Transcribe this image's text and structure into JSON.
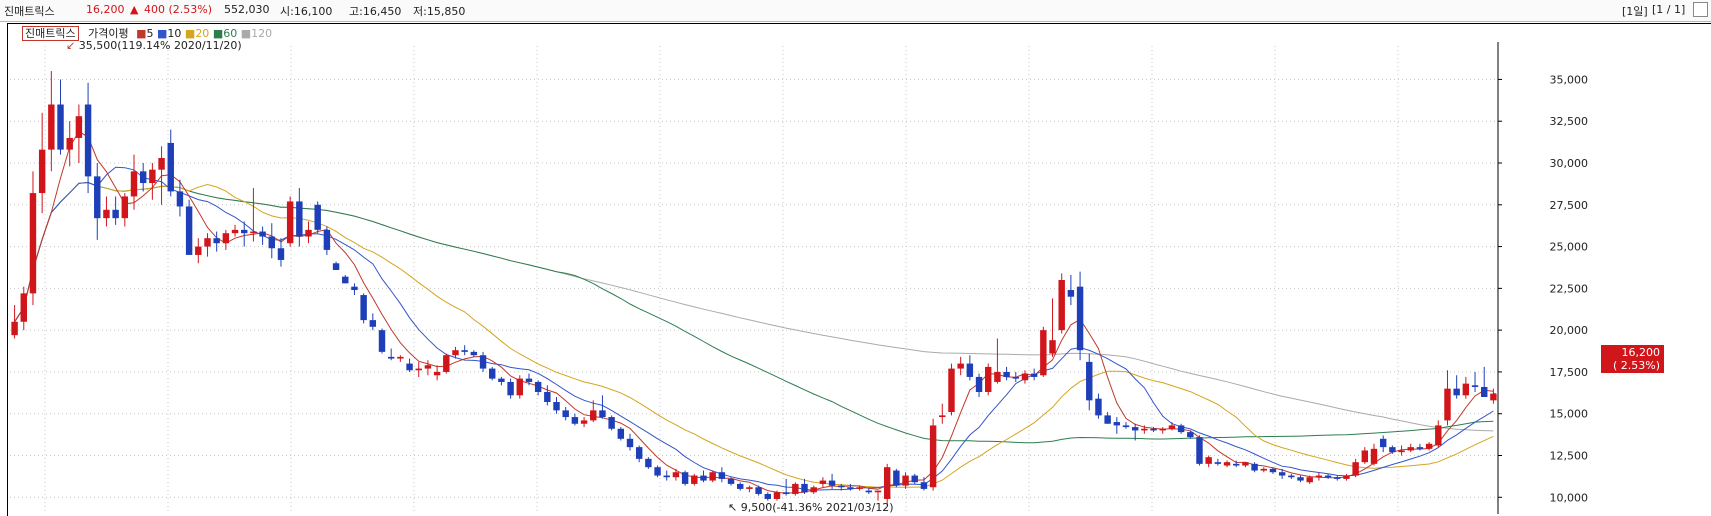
{
  "header": {
    "stock_name": "진매트릭스",
    "price": "16,200",
    "change_arrow": "▲",
    "change": "400 (2.53%)",
    "volume": "552,030",
    "open": "시:16,100",
    "high": "고:16,450",
    "low": "저:15,850",
    "period": "[1일]",
    "page": "[1 / 1]"
  },
  "legend": {
    "name": "진매트릭스",
    "ma_title": "가격이평",
    "periods": [
      {
        "label": "5",
        "color": "#c0392b"
      },
      {
        "label": "10",
        "color": "#3355cc"
      },
      {
        "label": "20",
        "color": "#d4a520"
      },
      {
        "label": "60",
        "color": "#2e7d4f"
      },
      {
        "label": "120",
        "color": "#aaaaaa"
      }
    ]
  },
  "annotations": {
    "high": "35,500(119.14% 2020/11/20)",
    "low": "9,500(-41.36% 2021/03/12)"
  },
  "price_tag": {
    "price": "16,200",
    "pct": "( 2.53%)"
  },
  "colors": {
    "up": "#d0161b",
    "down": "#1f3fb8",
    "bg": "#ffffff",
    "grid": "#c8c8c8"
  },
  "chart_data": {
    "type": "candlestick",
    "ylim": [
      9000,
      37000
    ],
    "yticks": [
      10000,
      12500,
      15000,
      17500,
      20000,
      22500,
      25000,
      27500,
      30000,
      32500,
      35000
    ],
    "ytick_labels": [
      "10,000",
      "12,500",
      "15,000",
      "17,500",
      "20,000",
      "22,500",
      "25,000",
      "27,500",
      "30,000",
      "32,500",
      "35,000"
    ],
    "candles": [
      [
        19700,
        21500,
        19500,
        20500
      ],
      [
        20500,
        22600,
        20000,
        22200
      ],
      [
        22200,
        29500,
        21500,
        28200
      ],
      [
        28200,
        33000,
        27000,
        30800
      ],
      [
        30800,
        35500,
        29500,
        33500
      ],
      [
        33500,
        35000,
        30500,
        30800
      ],
      [
        30800,
        32500,
        29800,
        31500
      ],
      [
        31500,
        33500,
        30000,
        32800
      ],
      [
        33500,
        34800,
        28200,
        29200
      ],
      [
        29200,
        30000,
        25400,
        26700
      ],
      [
        26700,
        28000,
        26200,
        27200
      ],
      [
        27200,
        28000,
        26300,
        26700
      ],
      [
        26700,
        28200,
        26200,
        28000
      ],
      [
        28000,
        30500,
        27200,
        29500
      ],
      [
        29500,
        30000,
        28300,
        28800
      ],
      [
        28800,
        30000,
        27800,
        29600
      ],
      [
        29600,
        31000,
        27500,
        30300
      ],
      [
        31200,
        32000,
        28000,
        28300
      ],
      [
        28300,
        29000,
        26800,
        27400
      ],
      [
        27400,
        27800,
        25100,
        24500
      ],
      [
        24500,
        25500,
        24000,
        25000
      ],
      [
        25000,
        25800,
        24400,
        25500
      ],
      [
        25500,
        25900,
        24700,
        25200
      ],
      [
        25200,
        26000,
        24800,
        25800
      ],
      [
        25800,
        26300,
        25600,
        26000
      ],
      [
        26000,
        26500,
        25000,
        25800
      ],
      [
        25800,
        28500,
        25300,
        25900
      ],
      [
        25900,
        26200,
        25100,
        25600
      ],
      [
        25600,
        26400,
        24300,
        24900
      ],
      [
        24900,
        25500,
        23800,
        24200
      ],
      [
        25200,
        28000,
        25000,
        27700
      ],
      [
        27700,
        28500,
        25000,
        25600
      ],
      [
        25600,
        26500,
        25200,
        26000
      ],
      [
        27500,
        27700,
        25800,
        26000
      ],
      [
        26000,
        26200,
        24500,
        24800
      ],
      [
        24000,
        24100,
        23600,
        23600
      ],
      [
        23200,
        23300,
        22800,
        22800
      ],
      [
        22600,
        22800,
        22100,
        22400
      ],
      [
        22100,
        22200,
        20400,
        20600
      ],
      [
        20600,
        21000,
        20000,
        20200
      ],
      [
        20000,
        20100,
        18600,
        18700
      ],
      [
        18400,
        18900,
        18200,
        18300
      ],
      [
        18300,
        18500,
        18100,
        18400
      ],
      [
        18000,
        18300,
        17500,
        17600
      ],
      [
        17600,
        18100,
        17200,
        17700
      ],
      [
        17700,
        18200,
        17300,
        17900
      ],
      [
        17300,
        17900,
        17000,
        17500
      ],
      [
        17500,
        18600,
        17400,
        18500
      ],
      [
        18500,
        19000,
        18300,
        18800
      ],
      [
        18800,
        19100,
        18500,
        18700
      ],
      [
        18700,
        18800,
        18400,
        18500
      ],
      [
        18500,
        18700,
        17500,
        17700
      ],
      [
        17700,
        17800,
        17000,
        17100
      ],
      [
        17100,
        17200,
        16700,
        16900
      ],
      [
        16900,
        17100,
        15900,
        16100
      ],
      [
        16100,
        17300,
        15900,
        17100
      ],
      [
        17100,
        17400,
        16700,
        16900
      ],
      [
        16900,
        17000,
        16100,
        16300
      ],
      [
        16300,
        16700,
        15500,
        15700
      ],
      [
        15700,
        16000,
        15000,
        15200
      ],
      [
        15200,
        15400,
        14600,
        14800
      ],
      [
        14800,
        15000,
        14300,
        14400
      ],
      [
        14400,
        14800,
        14200,
        14600
      ],
      [
        14600,
        15800,
        14500,
        15200
      ],
      [
        15200,
        16100,
        14700,
        14800
      ],
      [
        14800,
        14900,
        14000,
        14100
      ],
      [
        14100,
        14200,
        13400,
        13500
      ],
      [
        13500,
        13800,
        12800,
        13000
      ],
      [
        13000,
        13100,
        12100,
        12300
      ],
      [
        12300,
        12400,
        11700,
        11800
      ],
      [
        11800,
        11900,
        11200,
        11300
      ],
      [
        11300,
        11600,
        11000,
        11200
      ],
      [
        11200,
        11700,
        11000,
        11500
      ],
      [
        11500,
        11600,
        10700,
        10800
      ],
      [
        10800,
        11400,
        10700,
        11300
      ],
      [
        11300,
        11600,
        10900,
        11000
      ],
      [
        11000,
        11600,
        10900,
        11500
      ],
      [
        11500,
        11800,
        10900,
        11100
      ],
      [
        11100,
        11200,
        10700,
        10800
      ],
      [
        10800,
        10900,
        10400,
        10500
      ],
      [
        10500,
        10700,
        10300,
        10600
      ],
      [
        10600,
        10700,
        10100,
        10200
      ],
      [
        10200,
        10300,
        9800,
        9900
      ],
      [
        9900,
        10400,
        9800,
        10300
      ],
      [
        10300,
        11100,
        10100,
        10200
      ],
      [
        10200,
        10900,
        10100,
        10800
      ],
      [
        10800,
        11100,
        10200,
        10300
      ],
      [
        10300,
        10700,
        10200,
        10600
      ],
      [
        10800,
        11200,
        10600,
        11000
      ],
      [
        11000,
        11400,
        10500,
        10700
      ],
      [
        10700,
        10800,
        10400,
        10600
      ],
      [
        10600,
        10800,
        10400,
        10500
      ],
      [
        10500,
        10700,
        10400,
        10600
      ],
      [
        10400,
        10600,
        10200,
        10300
      ],
      [
        10300,
        10400,
        9800,
        10400
      ],
      [
        9900,
        12000,
        9500,
        11800
      ],
      [
        11600,
        11700,
        10600,
        10700
      ],
      [
        10700,
        11500,
        10500,
        11300
      ],
      [
        11300,
        11400,
        10800,
        10900
      ],
      [
        10900,
        11200,
        10400,
        10500
      ],
      [
        10600,
        14700,
        10400,
        14300
      ],
      [
        14800,
        15600,
        14400,
        14900
      ],
      [
        15100,
        18000,
        14900,
        17700
      ],
      [
        17700,
        18400,
        17300,
        18000
      ],
      [
        18000,
        18500,
        17000,
        17200
      ],
      [
        17200,
        17400,
        16000,
        16300
      ],
      [
        16300,
        18000,
        16100,
        17800
      ],
      [
        16900,
        19500,
        16800,
        17500
      ],
      [
        17500,
        17800,
        17000,
        17200
      ],
      [
        17200,
        17500,
        16900,
        17100
      ],
      [
        17000,
        17600,
        16800,
        17400
      ],
      [
        17400,
        17700,
        17000,
        17200
      ],
      [
        17300,
        20200,
        17200,
        20000
      ],
      [
        18600,
        21900,
        18400,
        19400
      ],
      [
        20000,
        23400,
        19800,
        23000
      ],
      [
        22400,
        23300,
        21500,
        22000
      ],
      [
        22600,
        23500,
        18200,
        18800
      ],
      [
        18100,
        18600,
        15200,
        15800
      ],
      [
        15900,
        16200,
        14700,
        14900
      ],
      [
        14900,
        15100,
        14400,
        14400
      ],
      [
        14500,
        14800,
        13800,
        14300
      ],
      [
        14300,
        14500,
        14100,
        14200
      ],
      [
        14200,
        14400,
        13400,
        14000
      ],
      [
        14000,
        14300,
        13800,
        14100
      ],
      [
        14100,
        14200,
        13900,
        14000
      ],
      [
        14000,
        14200,
        13800,
        14100
      ],
      [
        14100,
        14500,
        14000,
        14300
      ],
      [
        14300,
        14400,
        13800,
        13900
      ],
      [
        13900,
        14000,
        13500,
        13600
      ],
      [
        13600,
        13700,
        11900,
        12000
      ],
      [
        12000,
        12500,
        11800,
        12400
      ],
      [
        12100,
        12300,
        11900,
        12000
      ],
      [
        11900,
        12200,
        11800,
        12100
      ],
      [
        12000,
        12200,
        11800,
        11900
      ],
      [
        11900,
        12100,
        11800,
        12100
      ],
      [
        12000,
        12100,
        11500,
        11600
      ],
      [
        11600,
        11800,
        11500,
        11700
      ],
      [
        11700,
        11800,
        11400,
        11500
      ],
      [
        11500,
        11700,
        11100,
        11300
      ],
      [
        11300,
        11400,
        11100,
        11200
      ],
      [
        11200,
        11300,
        10900,
        11000
      ],
      [
        10900,
        11300,
        10800,
        11200
      ],
      [
        11200,
        11500,
        11000,
        11300
      ],
      [
        11300,
        11400,
        11100,
        11200
      ],
      [
        11200,
        11300,
        11000,
        11100
      ],
      [
        11100,
        11400,
        11000,
        11300
      ],
      [
        11300,
        12300,
        11200,
        12100
      ],
      [
        12100,
        13000,
        12000,
        12800
      ],
      [
        12000,
        13200,
        11900,
        12900
      ],
      [
        13500,
        13700,
        12700,
        13000
      ],
      [
        13000,
        13100,
        12600,
        12700
      ],
      [
        12700,
        13100,
        12500,
        12800
      ],
      [
        12800,
        13200,
        12700,
        13000
      ],
      [
        13000,
        13200,
        12800,
        12900
      ],
      [
        12900,
        13300,
        12800,
        13200
      ],
      [
        13100,
        14600,
        13000,
        14300
      ],
      [
        14600,
        17600,
        14300,
        16500
      ],
      [
        16500,
        17300,
        15900,
        16100
      ],
      [
        16100,
        17200,
        15900,
        16800
      ],
      [
        16700,
        17500,
        16300,
        16600
      ],
      [
        16600,
        17800,
        16200,
        16000
      ],
      [
        15800,
        16500,
        15600,
        16200
      ]
    ]
  }
}
